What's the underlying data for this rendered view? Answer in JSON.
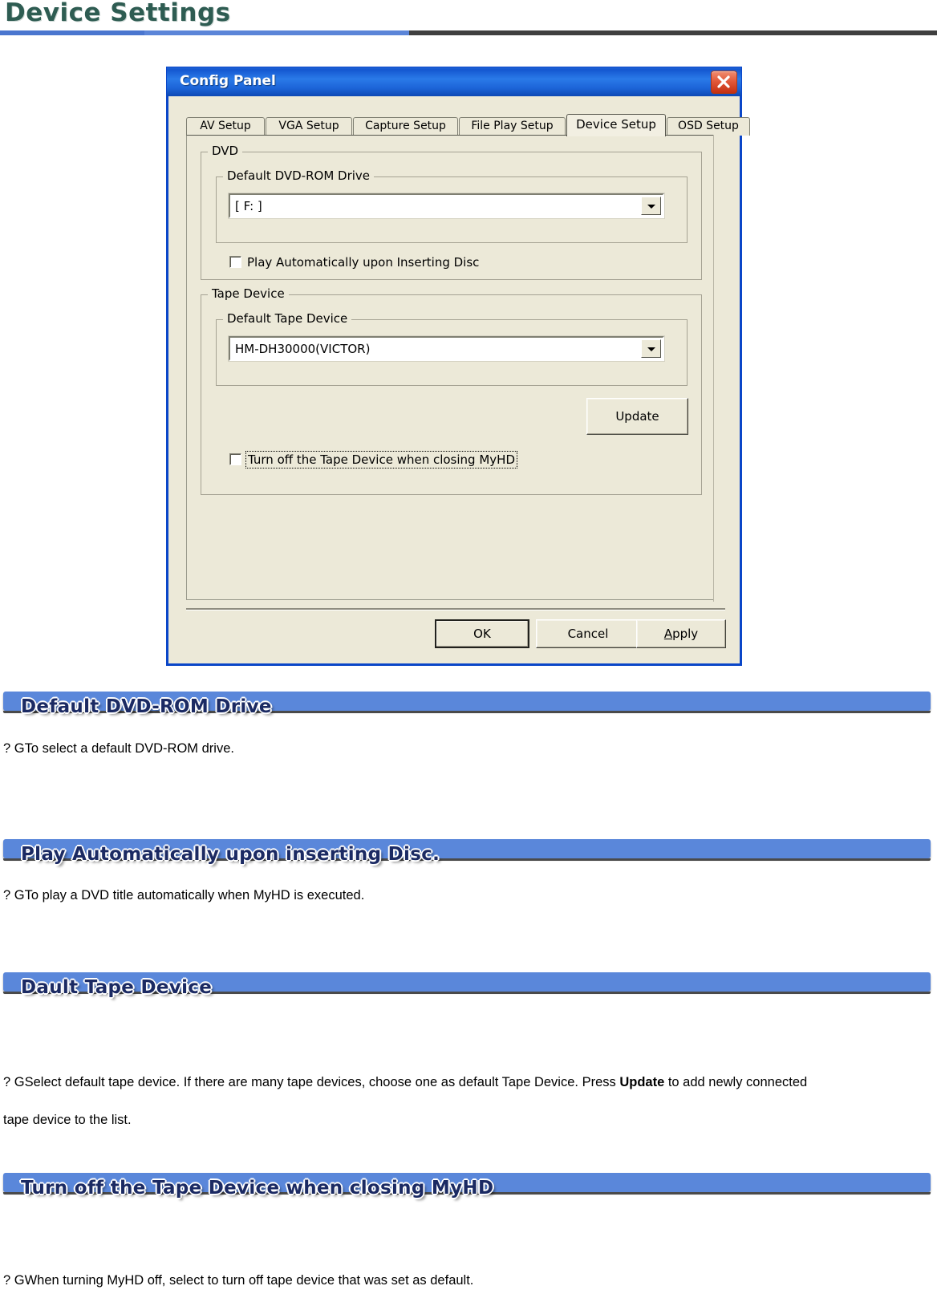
{
  "page": {
    "title": "Device Settings"
  },
  "dialog": {
    "title": "Config Panel",
    "close_icon": "close-icon",
    "tabs": [
      {
        "label": "AV Setup",
        "selected": false
      },
      {
        "label": "VGA Setup",
        "selected": false
      },
      {
        "label": "Capture Setup",
        "selected": false
      },
      {
        "label": "File Play Setup",
        "selected": false
      },
      {
        "label": "Device Setup",
        "selected": true
      },
      {
        "label": "OSD Setup",
        "selected": false
      }
    ],
    "dvd_group": {
      "legend": "DVD",
      "drive_group_legend": "Default DVD-ROM Drive",
      "drive_value": "[ F: ]",
      "autoplay_label": "Play Automatically upon Inserting Disc",
      "autoplay_checked": false
    },
    "tape_group": {
      "legend": "Tape Device",
      "device_group_legend": "Default Tape Device",
      "device_value": "HM-DH30000(VICTOR)",
      "update_label": "Update",
      "turnoff_label": "Turn off the Tape Device when closing MyHD",
      "turnoff_checked": false
    },
    "buttons": {
      "ok": "OK",
      "cancel": "Cancel",
      "apply_prefix": "A",
      "apply_suffix": "pply"
    }
  },
  "sections": [
    {
      "heading": "Default DVD-ROM Drive",
      "bullet": "?  G",
      "text": "To select a default DVD-ROM drive."
    },
    {
      "heading": "Play Automatically upon inserting Disc.",
      "bullet": "?  G",
      "text": "To play a DVD title automatically when MyHD is executed."
    },
    {
      "heading": "Dault Tape Device",
      "bullet": "?  G",
      "text_part1": "Select default tape device. If there are many tape devices, choose one as default Tape Device. Press ",
      "text_bold": "Update",
      "text_part2": "  to add newly connected",
      "text_line2": "tape device to the list."
    },
    {
      "heading": "Turn off the Tape Device when closing MyHD",
      "bullet": "?  G",
      "text": "When turning MyHD off, select to turn off tape device that was set as default."
    }
  ],
  "colors": {
    "banner_blue": "#5a87da",
    "banner_text": "#1b2a63",
    "title_green": "#2e5c52",
    "dialog_face": "#ece9d8",
    "titlebar_blue": "#1457d0"
  }
}
